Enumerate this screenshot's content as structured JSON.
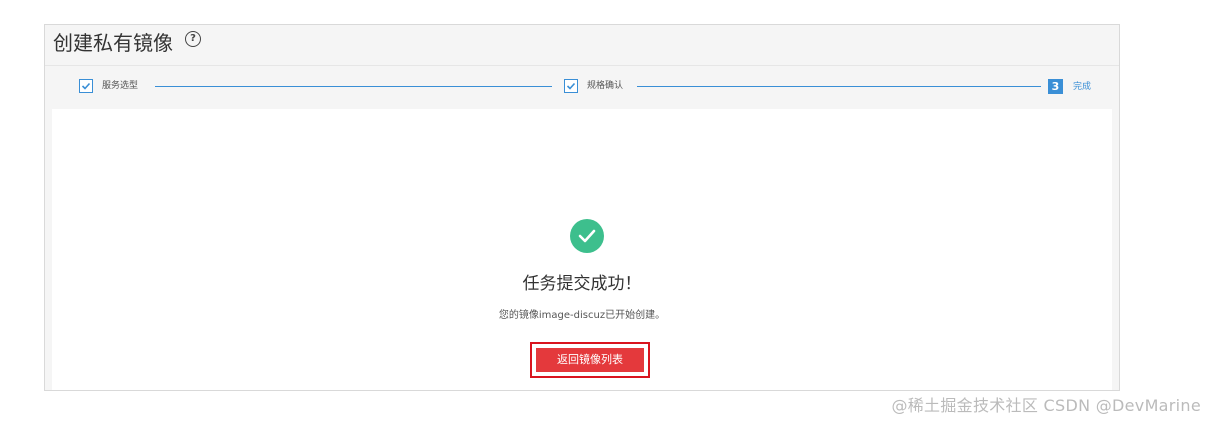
{
  "header": {
    "title": "创建私有镜像",
    "help_icon": "question-circle-icon",
    "help_glyph": "?"
  },
  "steps": [
    {
      "label": "服务选型",
      "status": "completed"
    },
    {
      "label": "规格确认",
      "status": "completed"
    },
    {
      "number": "3",
      "label": "完成",
      "status": "current"
    }
  ],
  "result": {
    "icon": "check-circle-icon",
    "icon_color": "#3dbf8d",
    "title": "任务提交成功！",
    "message": "您的镜像image-discuz已开始创建。",
    "button_label": "返回镜像列表",
    "button_color": "#e4393c"
  },
  "watermark": "@稀土掘金技术社区 CSDN @DevMarine",
  "colors": {
    "accent": "#3a8fd6",
    "highlight_border": "#d9141e"
  }
}
